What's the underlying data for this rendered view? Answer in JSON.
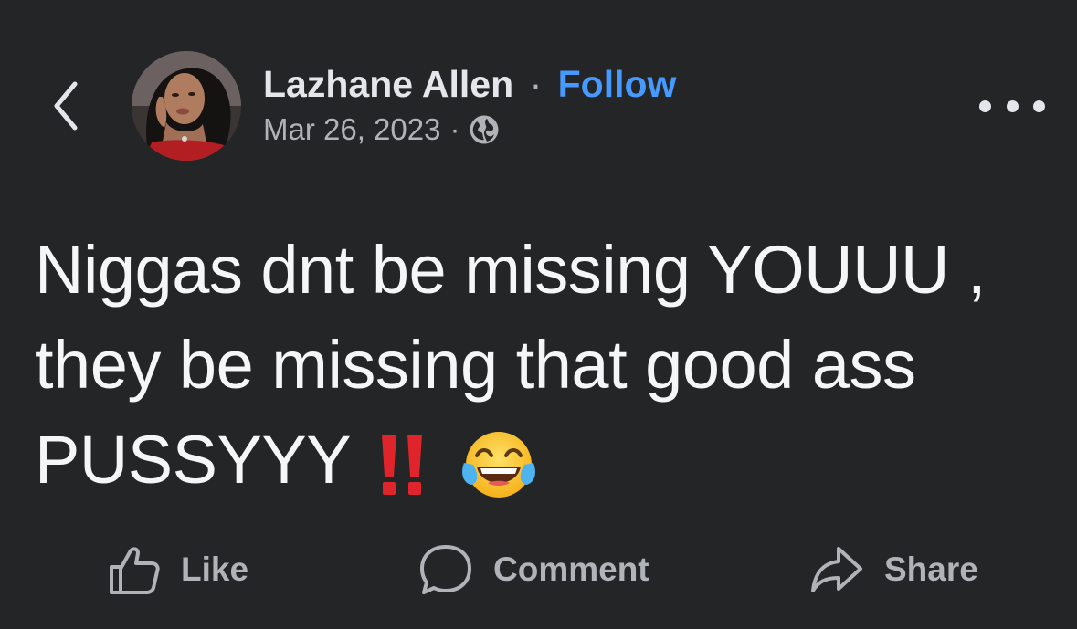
{
  "header": {
    "author_name": "Lazhane Allen",
    "separator": "·",
    "follow_label": "Follow",
    "date": "Mar 26, 2023",
    "audience_icon": "globe-icon"
  },
  "post": {
    "text": "Niggas dnt be missing YOUUU , they be missing that good ass PUSSYYY",
    "emojis": [
      "double-exclamation-icon",
      "tears-of-joy-emoji"
    ]
  },
  "actions": [
    {
      "label": "Like",
      "icon": "thumbs-up-icon"
    },
    {
      "label": "Comment",
      "icon": "comment-bubble-icon"
    },
    {
      "label": "Share",
      "icon": "share-arrow-icon"
    }
  ],
  "colors": {
    "background": "#242526",
    "text": "#e4e6eb",
    "secondary_text": "#b0b3b8",
    "follow_blue": "#4599ff",
    "exclamation_red": "#e0242b"
  }
}
